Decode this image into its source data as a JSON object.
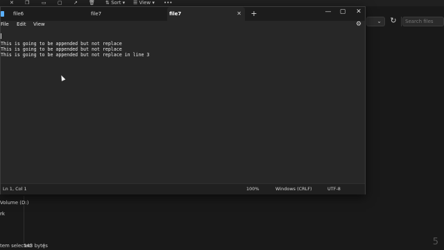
{
  "explorer": {
    "toolbar": {
      "items": [
        {
          "icon": "cut-icon",
          "label": ""
        },
        {
          "icon": "copy-icon",
          "label": ""
        },
        {
          "icon": "paste-icon",
          "label": ""
        },
        {
          "icon": "rename-icon",
          "label": ""
        },
        {
          "icon": "share-icon",
          "label": ""
        },
        {
          "icon": "delete-icon",
          "label": ""
        },
        {
          "icon": "sort-icon",
          "label": "Sort"
        },
        {
          "icon": "view-icon",
          "label": "View"
        },
        {
          "icon": "more-icon",
          "label": "•••"
        }
      ]
    },
    "search_placeholder": "Search files",
    "sidebar": [
      "Volume (D:)",
      "rk"
    ],
    "status": {
      "selection": "tem selected",
      "size": "143 bytes"
    },
    "corner_number": "5"
  },
  "notepad": {
    "tabs": [
      {
        "label": "file6",
        "active": false
      },
      {
        "label": "file7",
        "active": false
      },
      {
        "label": "file7",
        "active": true
      }
    ],
    "menu": [
      "File",
      "Edit",
      "View"
    ],
    "lines": [
      "",
      "This is going to be appended but not replace",
      "This is going to be appended but not replace",
      "This is going to be appended but not replace in line 3"
    ],
    "status": {
      "position": "Ln 1, Col 1",
      "zoom": "100%",
      "line_ending": "Windows (CRLF)",
      "encoding": "UTF-8"
    }
  },
  "colors": {
    "background": "#191919",
    "window": "#272727",
    "titlebar": "#1c1c1c",
    "accent": "#5ab0ff"
  }
}
